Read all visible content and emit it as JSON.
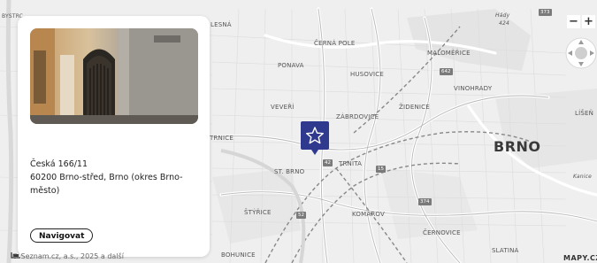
{
  "map": {
    "labels": {
      "bystrc": "BYSTRC",
      "lesna": "LESNÁ",
      "cerna_pole": "ČERNÁ POLE",
      "ponava": "PONAVA",
      "husovice": "HUSOVICE",
      "malomerice": "MALOMĚŘICE",
      "vinohrady": "VINOHRADY",
      "zidenice": "ŽIDENICE",
      "veveri": "VEVEŘÍ",
      "zabrdovice": "ZÁBRDOVICE",
      "lisen": "LÍŠEŇ",
      "bohunice_area": "TRNICE",
      "stary_brno": "ST. BRNO",
      "trnita": "TRNITA",
      "city": "BRNO",
      "styrice": "ŠTÝŘICE",
      "komarov": "KOMÁROV",
      "cernovice": "ČERNOVICE",
      "slatina": "SLATINA",
      "bohunice": "BOHUNICE",
      "hady": "Hády",
      "hady_elev": "424",
      "kanice": "Kanice",
      "road_373": "373",
      "road_642": "642",
      "road_374": "374",
      "road_52": "52",
      "road_a": "42",
      "road_b": "15"
    }
  },
  "card": {
    "address_line1": "Česká 166/11",
    "address_line2": "60200 Brno-střed, Brno (okres Brno-město)",
    "navigate_label": "Navigovat"
  },
  "controls": {
    "zoom_out": "−",
    "zoom_in": "+"
  },
  "footer": {
    "copyright": "© Seznam.cz, a.s., 2025 a další",
    "brand": "MAPY.CZ"
  },
  "colors": {
    "marker": "#2f3a8f",
    "map_bg": "#efefef"
  },
  "icons": {
    "marker": "star-icon",
    "compass": "compass-icon",
    "scale": "scale-icon"
  }
}
